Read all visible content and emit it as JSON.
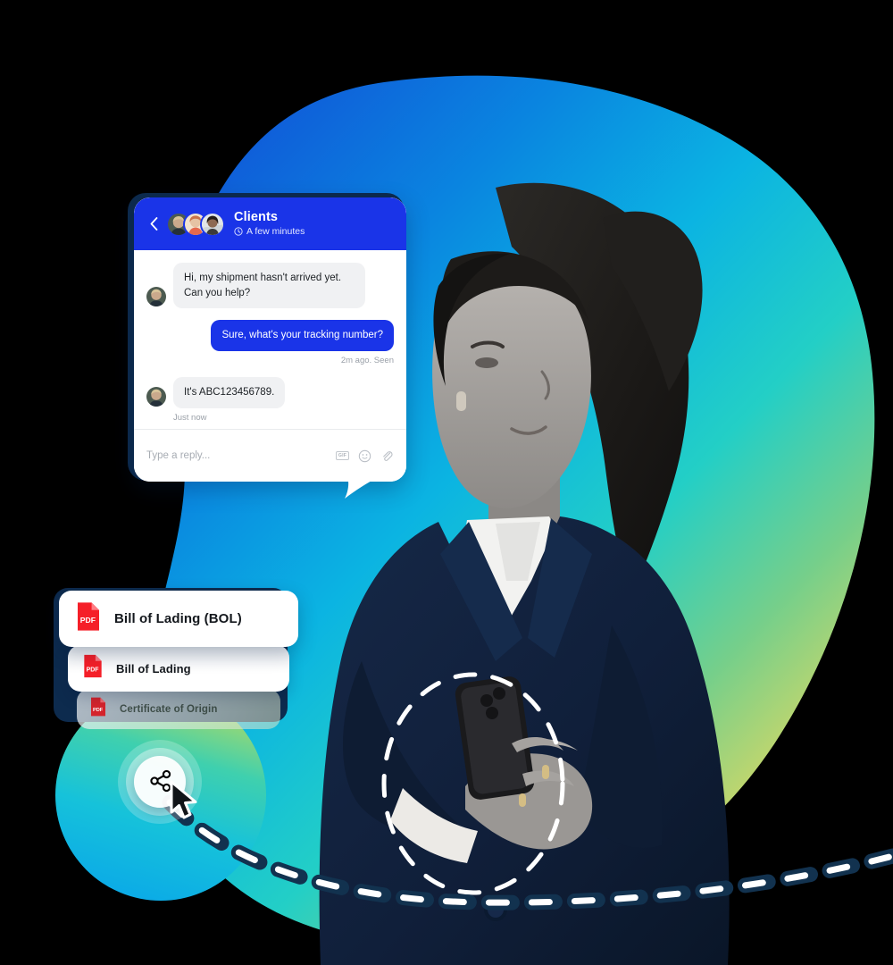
{
  "meta": {
    "scene": "Logistics customer-support hero illustration",
    "background_color": "#000000"
  },
  "palette": {
    "blob_blue": "#0b63d6",
    "blob_cyan": "#0fb6e0",
    "blob_teal": "#2ad0c4",
    "blob_green": "#8fd46a",
    "blob_yellow": "#ead95f",
    "chat_header_blue": "#1a34e8",
    "bubble_blue": "#1a34e8",
    "bubble_grey": "#f0f1f3",
    "pdf_red": "#f51f28",
    "navy_shadow": "#0d2b4e",
    "dash_white": "#ffffff",
    "dash_outline": "#12324f"
  },
  "chat": {
    "back_icon": "chevron-left-icon",
    "title": "Clients",
    "status_icon": "clock-icon",
    "status": "A few minutes",
    "avatars": [
      {
        "name": "avatar-client-1",
        "tone": "#8a6a52"
      },
      {
        "name": "avatar-client-2",
        "tone": "#e8896f"
      },
      {
        "name": "avatar-client-3",
        "tone": "#cfd4d8"
      }
    ],
    "messages": [
      {
        "id": "msg-1",
        "side": "in",
        "text": "Hi, my shipment hasn't arrived yet. Can you help?",
        "meta": "",
        "avatar": true
      },
      {
        "id": "msg-2",
        "side": "out",
        "text": "Sure, what's your tracking number?",
        "meta": "2m ago. Seen",
        "avatar": false
      },
      {
        "id": "msg-3",
        "side": "in",
        "text": "It's ABC123456789.",
        "meta": "Just now",
        "avatar": true
      }
    ],
    "input": {
      "placeholder": "Type a reply...",
      "value": "",
      "tools": [
        {
          "name": "gif-icon",
          "label": "GIF"
        },
        {
          "name": "emoji-icon",
          "label": ""
        },
        {
          "name": "attachment-icon",
          "label": ""
        }
      ]
    }
  },
  "documents": {
    "items": [
      {
        "id": "doc-1",
        "label": "Bill of Lading (BOL)",
        "icon": "pdf-file-icon"
      },
      {
        "id": "doc-2",
        "label": "Bill of Lading",
        "icon": "pdf-file-icon"
      },
      {
        "id": "doc-3",
        "label": "Certificate of Origin",
        "icon": "pdf-file-icon"
      }
    ]
  },
  "share": {
    "icon": "share-icon",
    "cursor": "mouse-pointer-icon",
    "ripple_count": 3
  },
  "decorations": {
    "dashed_circle": "dashed-circle-overlay",
    "dashed_trail": "dashed-path-trail",
    "speech_tail": "speech-bubble-tail"
  }
}
